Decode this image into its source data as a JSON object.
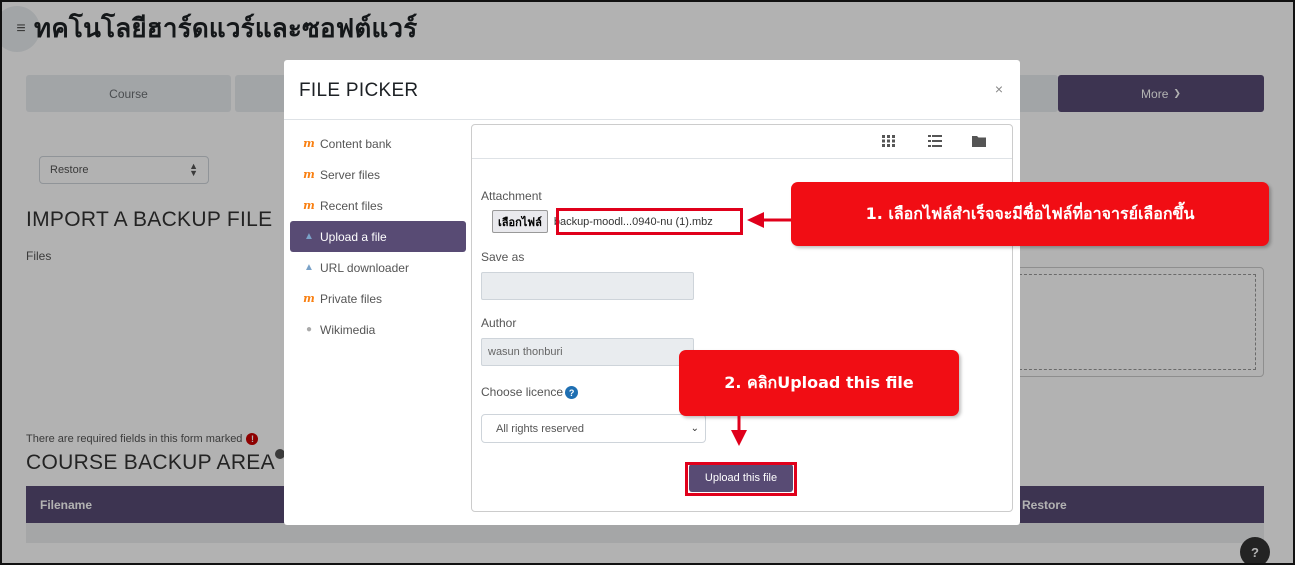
{
  "page": {
    "heading": "ทคโนโลยีฮาร์ดแวร์และซอฟต์แวร์",
    "nav": {
      "course_tab": "Course",
      "more_tab": "More"
    },
    "restore_select": "Restore",
    "import_heading": "IMPORT A BACKUP FILE",
    "files_label": "Files",
    "required_note": "There are required fields in this form marked",
    "backup_area_heading": "COURSE BACKUP AREA",
    "table": {
      "col_filename": "Filename",
      "col_restore": "Restore"
    },
    "help_button": "?"
  },
  "file_picker": {
    "title": "FILE PICKER",
    "close_glyph": "×",
    "repositories": [
      {
        "label": "Content bank",
        "icon": "moodle-icon"
      },
      {
        "label": "Server files",
        "icon": "moodle-icon"
      },
      {
        "label": "Recent files",
        "icon": "moodle-icon"
      },
      {
        "label": "Upload a file",
        "icon": "upload-icon",
        "active": true
      },
      {
        "label": "URL downloader",
        "icon": "url-downloader-icon"
      },
      {
        "label": "Private files",
        "icon": "moodle-icon"
      },
      {
        "label": "Wikimedia",
        "icon": "wikimedia-icon"
      }
    ],
    "view_icons": [
      "grid-view-icon",
      "list-view-icon",
      "folder-view-icon"
    ],
    "form": {
      "attachment_label": "Attachment",
      "choose_file_button": "เลือกไฟล์",
      "chosen_file_name": "backup-moodl...0940-nu (1).mbz",
      "save_as_label": "Save as",
      "save_as_value": "",
      "author_label": "Author",
      "author_value": "wasun thonburi",
      "licence_label": "Choose licence",
      "licence_value": "All rights reserved",
      "upload_button": "Upload this file"
    }
  },
  "annotations": {
    "callout_1": "1. เลือกไฟล์สำเร็จจะมีชื่อไฟล์ที่อาจารย์เลือกขึ้น",
    "callout_2": "2. คลิกUpload this file",
    "accent_color": "#f10d14"
  },
  "colors": {
    "brand_purple": "#584b74"
  }
}
